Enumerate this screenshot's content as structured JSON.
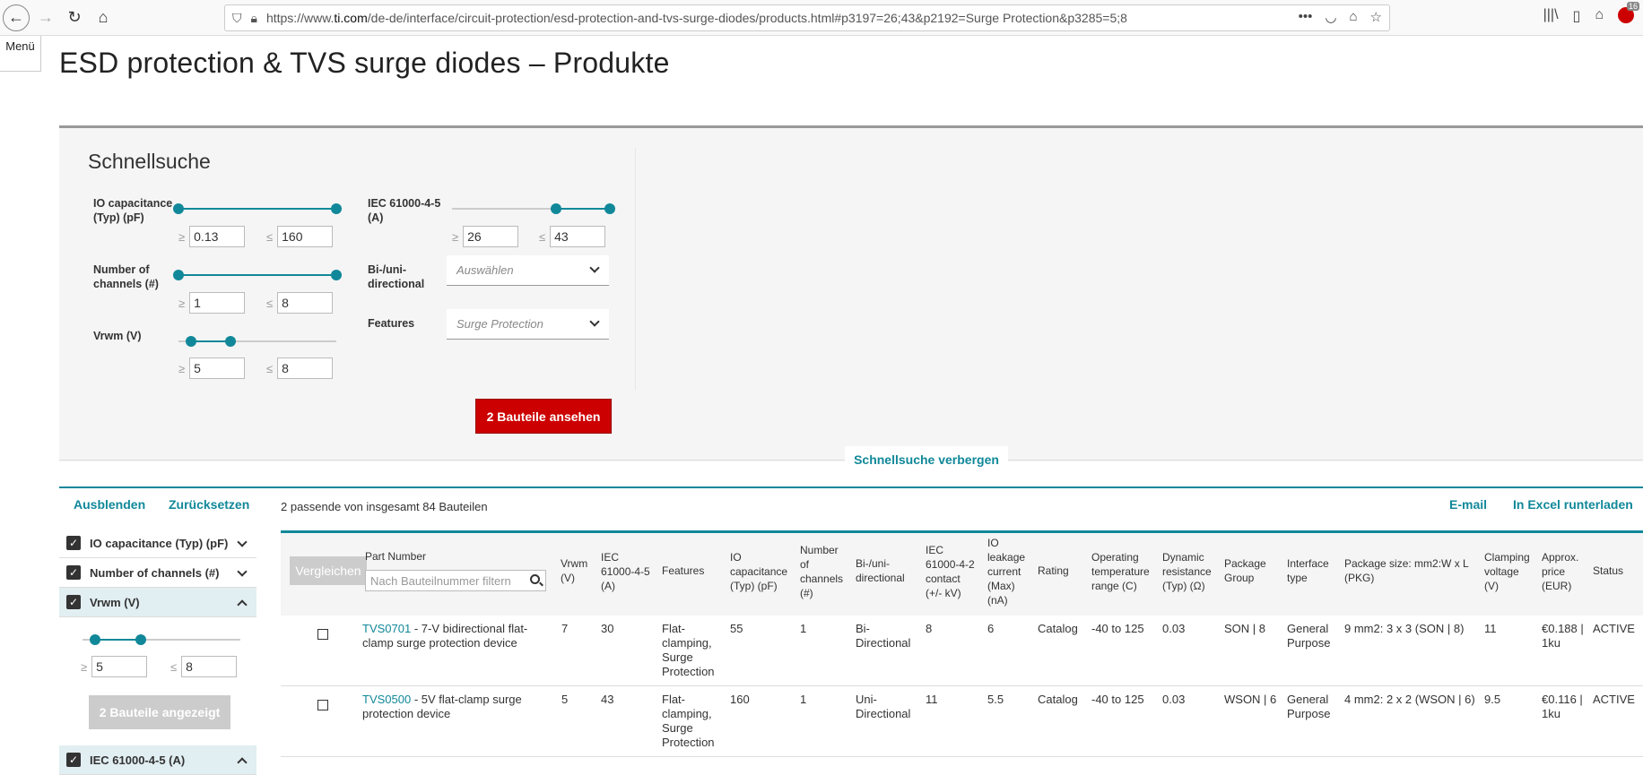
{
  "browser": {
    "url_prefix": "https://www.",
    "url_domain": "ti.com",
    "url_rest": "/de-de/interface/circuit-protection/esd-protection-and-tvs-surge-diodes/products.html#p3197=26;43&p2192=Surge Protection&p3285=5;8",
    "badge_count": "16"
  },
  "menu_label": "Menü",
  "page_title": "ESD protection & TVS surge diodes – Produkte",
  "quicksearch": {
    "title": "Schnellsuche",
    "filters": [
      {
        "label": "IO capacitance (Typ) (pF)",
        "min": "0.13",
        "max": "160",
        "range": [
          0,
          1
        ]
      },
      {
        "label": "Number of channels (#)",
        "min": "1",
        "max": "8",
        "range": [
          0,
          1
        ]
      },
      {
        "label": "Vrwm (V)",
        "min": "5",
        "max": "8",
        "range": [
          0.08,
          0.33
        ]
      },
      {
        "label": "IEC 61000-4-5 (A)",
        "min": "26",
        "max": "43",
        "range": [
          0.66,
          1
        ]
      }
    ],
    "bidir_label": "Bi-/uni-directional",
    "bidir_value": "Auswählen",
    "features_label": "Features",
    "features_value": "Surge Protection",
    "ge": "≥",
    "le": "≤",
    "view_button": "2 Bauteile ansehen",
    "hide_link": "Schnellsuche verbergen"
  },
  "results": {
    "hide": "Ausblenden",
    "reset": "Zurücksetzen",
    "count_text": "2 passende von insgesamt 84 Bauteilen",
    "email": "E-mail",
    "excel": "In Excel runterladen"
  },
  "sidebar": {
    "items": [
      {
        "label": "IO capacitance (Typ) (pF)"
      },
      {
        "label": "Number of channels (#)"
      },
      {
        "label": "Vrwm (V)"
      },
      {
        "label": "IEC 61000-4-5 (A)"
      }
    ],
    "vrwm_min": "5",
    "vrwm_max": "8",
    "vrwm_range": [
      0.08,
      0.37
    ],
    "shown_button": "2 Bauteile angezeigt"
  },
  "table": {
    "compare": "Vergleichen",
    "search_placeholder": "Nach Bauteilnummer filtern",
    "headers": {
      "part": "Part Number",
      "vrwm": "Vrwm (V)",
      "iec45": "IEC 61000-4-5 (A)",
      "features": "Features",
      "iocap": "IO capacitance (Typ) (pF)",
      "channels": "Number of channels (#)",
      "bidir": "Bi-/uni-directional",
      "iec42": "IEC 61000-4-2 contact (+/- kV)",
      "leak": "IO leakage current (Max) (nA)",
      "rating": "Rating",
      "temp": "Operating temperature range (C)",
      "dynres": "Dynamic resistance (Typ) (Ω)",
      "pkg": "Package Group",
      "iface": "Interface type",
      "pkgsize": "Package size: mm2:W x L (PKG)",
      "clamp": "Clamping voltage (V)",
      "price": "Approx. price (EUR)",
      "status": "Status"
    },
    "rows": [
      {
        "part": "TVS0701",
        "desc": " - 7-V bidirectional flat-clamp surge protection device",
        "vrwm": "7",
        "iec45": "30",
        "features": "Flat-clamping, Surge Protection",
        "iocap": "55",
        "channels": "1",
        "bidir": "Bi-Directional",
        "iec42": "8",
        "leak": "6",
        "rating": "Catalog",
        "temp": "-40 to 125",
        "dynres": "0.03",
        "pkg": "SON | 8",
        "iface": "General Purpose",
        "pkgsize": "9 mm2: 3 x 3 (SON | 8)",
        "clamp": "11",
        "price": "€0.188 | 1ku",
        "status": "ACTIVE"
      },
      {
        "part": "TVS0500",
        "desc": " - 5V flat-clamp surge protection device",
        "vrwm": "5",
        "iec45": "43",
        "features": "Flat-clamping, Surge Protection",
        "iocap": "160",
        "channels": "1",
        "bidir": "Uni-Directional",
        "iec42": "11",
        "leak": "5.5",
        "rating": "Catalog",
        "temp": "-40 to 125",
        "dynres": "0.03",
        "pkg": "WSON | 6",
        "iface": "General Purpose",
        "pkgsize": "4 mm2: 2 x 2 (WSON | 6)",
        "clamp": "9.5",
        "price": "€0.116 | 1ku",
        "status": "ACTIVE"
      }
    ]
  }
}
